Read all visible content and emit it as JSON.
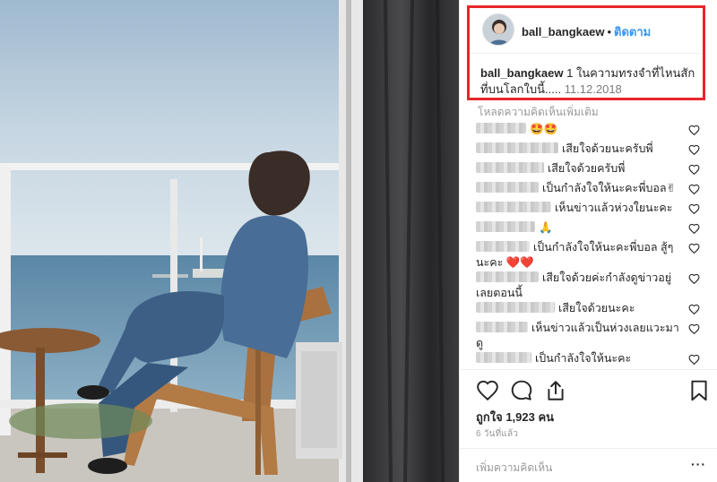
{
  "post": {
    "username": "ball_bangkaew",
    "separator": "•",
    "follow_label": "ติดตาม",
    "caption_text": " 1 ในความทรงจำที่ไหนสักที่บนโลกใบนี้..... ",
    "caption_date": "11.12.2018"
  },
  "comments_section": {
    "load_more_label": "โหลดความคิดเห็นเพิ่มเติม",
    "items": [
      {
        "text": "🤩🤩"
      },
      {
        "text": "เสียใจด้วยนะครับพี่"
      },
      {
        "text": "เสียใจด้วยครับพี่"
      },
      {
        "text": "เป็นกำลังใจให้นะคะพี่บอล✌"
      },
      {
        "text": "เห็นข่าวแล้วห่วงใยนะคะ"
      },
      {
        "text": "🙏"
      },
      {
        "text": "เป็นกำลังใจให้นะคะพี่บอล สู้ๆนะคะ ❤️❤️"
      },
      {
        "text": "เสียใจด้วยค่ะกำลังดูข่าวอยู่เลยตอนนี้"
      },
      {
        "text": "เสียใจด้วยนะคะ"
      },
      {
        "text": "เห็นข่าวแล้วเป็นห่วงเลยแวะมาดู"
      },
      {
        "text": "เป็นกำลังใจให้นะคะ"
      }
    ]
  },
  "actions": {
    "like_icon": "heart-outline-icon",
    "comment_icon": "comment-bubble-icon",
    "share_icon": "share-icon",
    "save_icon": "bookmark-icon"
  },
  "likes_text": "ถูกใจ 1,923 คน",
  "time_text": "6 วันที่แล้ว",
  "comment_input": {
    "placeholder": "เพิ่มความคิดเห็น"
  },
  "more_label": "···",
  "colors": {
    "follow_blue": "#3897f0",
    "highlight_red": "#e8262b",
    "text_dark": "#262626",
    "text_muted": "#999999"
  }
}
